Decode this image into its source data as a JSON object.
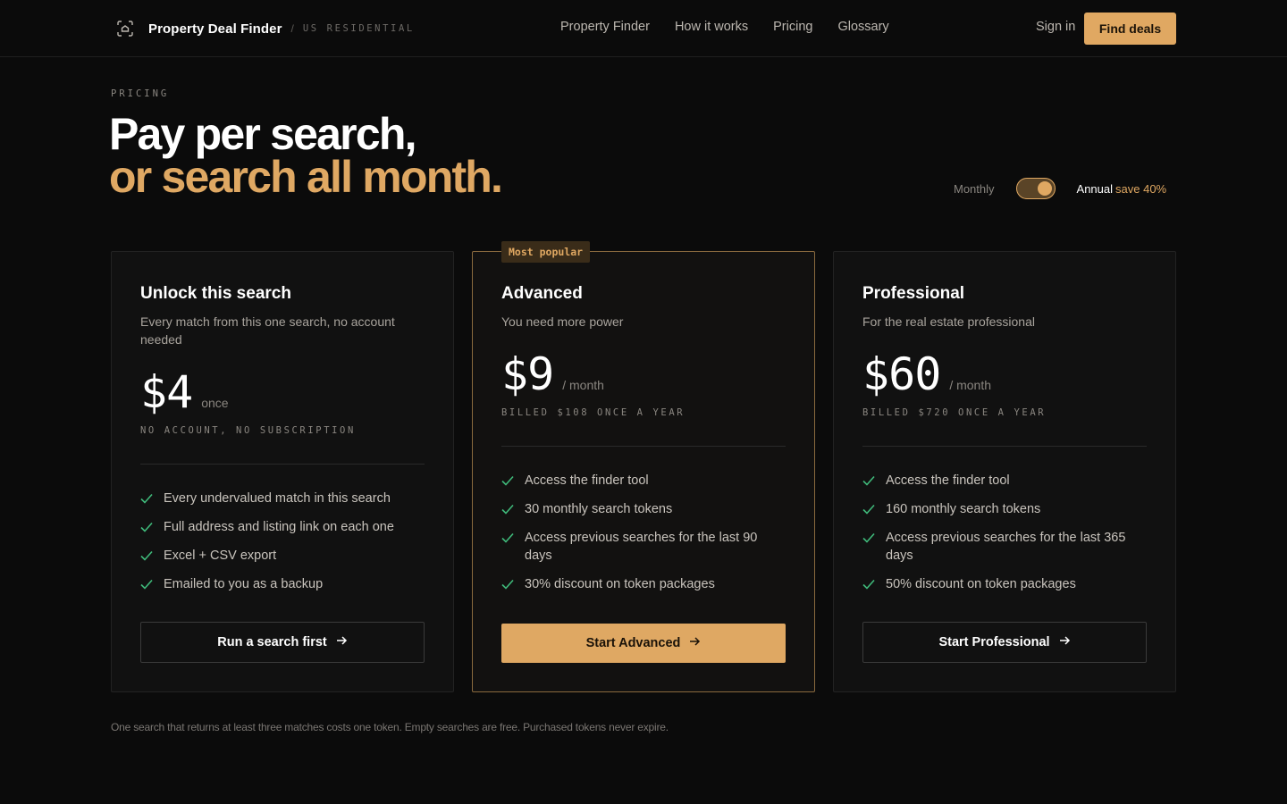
{
  "header": {
    "brand_name": "Property Deal Finder",
    "brand_separator": "/",
    "brand_tag": "US RESIDENTIAL",
    "nav": [
      "Property Finder",
      "How it works",
      "Pricing",
      "Glossary"
    ],
    "sign_in": "Sign in",
    "find_deals": "Find deals"
  },
  "hero": {
    "eyebrow": "PRICING",
    "title_line1": "Pay per search,",
    "title_line2": "or search all month."
  },
  "billing": {
    "monthly_label": "Monthly",
    "annual_label": "Annual",
    "save_label": "save 40%",
    "annual_selected": true
  },
  "plans": [
    {
      "name": "Unlock this search",
      "description": "Every match from this one search, no account needed",
      "price": "$4",
      "period": "once",
      "billing_note": "NO ACCOUNT, NO SUBSCRIPTION",
      "features": [
        "Every undervalued match in this search",
        "Full address and listing link on each one",
        "Excel + CSV export",
        "Emailed to you as a backup"
      ],
      "cta": "Run a search first"
    },
    {
      "badge": "Most popular",
      "name": "Advanced",
      "description": "You need more power",
      "price": "$9",
      "period": "/ month",
      "billing_note": "BILLED $108 ONCE A YEAR",
      "features": [
        "Access the finder tool",
        "30 monthly search tokens",
        "Access previous searches for the last 90 days",
        "30% discount on token packages"
      ],
      "cta": "Start Advanced"
    },
    {
      "name": "Professional",
      "description": "For the real estate professional",
      "price": "$60",
      "period": "/ month",
      "billing_note": "BILLED $720 ONCE A YEAR",
      "features": [
        "Access the finder tool",
        "160 monthly search tokens",
        "Access previous searches for the last 365 days",
        "50% discount on token packages"
      ],
      "cta": "Start Professional"
    }
  ],
  "footnote": "One search that returns at least three matches costs one token. Empty searches are free. Purchased tokens never expire.",
  "colors": {
    "accent": "#e0a862",
    "background": "#0b0b0b",
    "card": "#111111",
    "check": "#3fb97a"
  },
  "icons": [
    "scan-icon",
    "check-icon",
    "arrow-right-icon"
  ]
}
